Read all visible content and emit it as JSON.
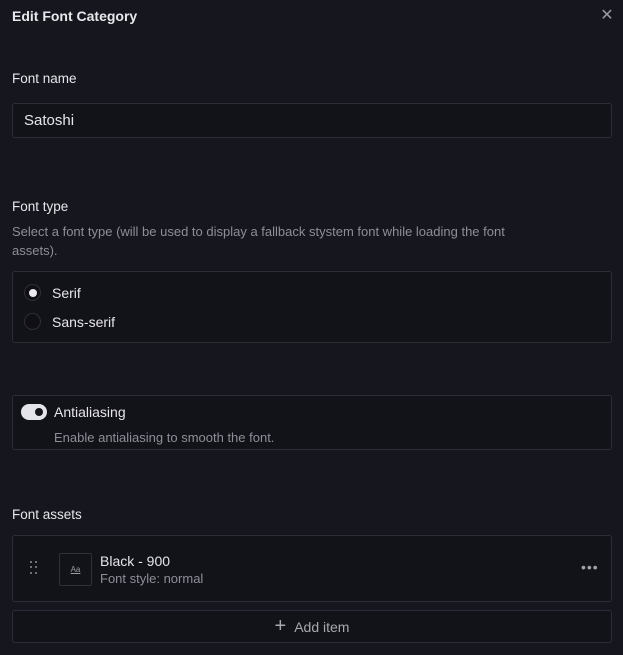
{
  "dialog": {
    "title": "Edit Font Category",
    "close_icon": "close-icon"
  },
  "font_name": {
    "label": "Font name",
    "value": "Satoshi"
  },
  "font_type": {
    "label": "Font type",
    "description": "Select a font type (will be used to display a fallback stystem font while loading the font assets).",
    "options": [
      {
        "label": "Serif",
        "selected": true
      },
      {
        "label": "Sans-serif",
        "selected": false
      }
    ]
  },
  "antialiasing": {
    "label": "Antialiasing",
    "description": "Enable antialiasing to smooth the font.",
    "enabled": true
  },
  "font_assets": {
    "label": "Font assets",
    "items": [
      {
        "preview": "Aa",
        "title": "Black - 900",
        "subtitle": "Font style: normal"
      }
    ],
    "add_label": "Add item"
  }
}
